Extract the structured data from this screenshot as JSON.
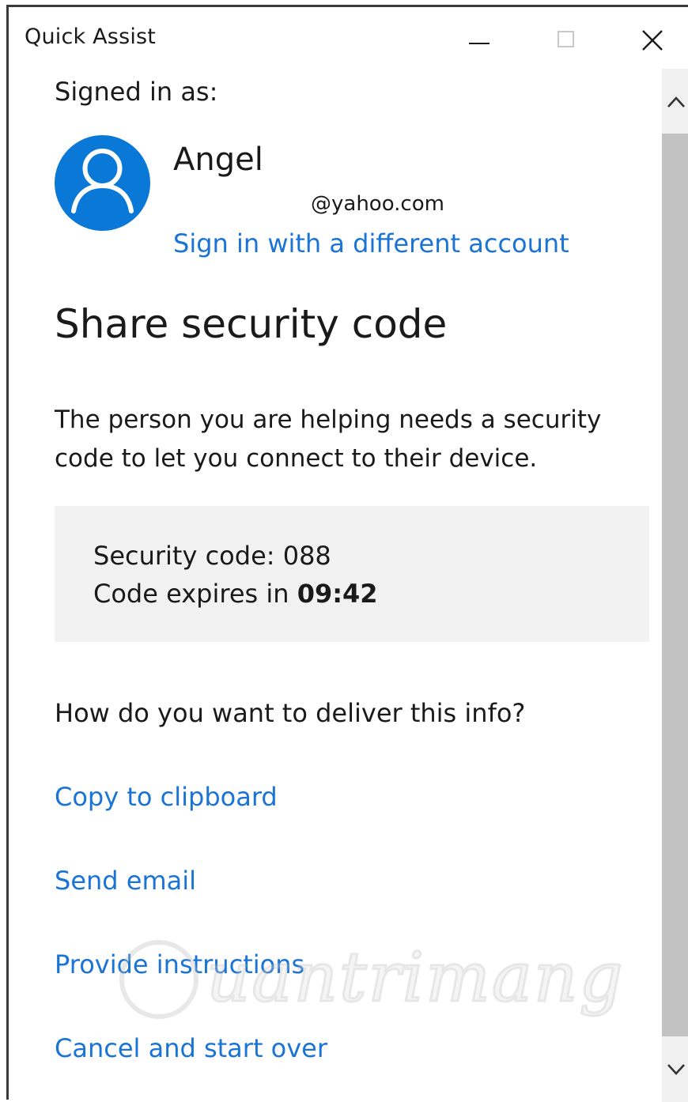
{
  "window": {
    "title": "Quick Assist"
  },
  "account": {
    "signed_in_label": "Signed in as:",
    "name": "Angel",
    "email": "@yahoo.com",
    "switch_link": "Sign in with a different account"
  },
  "main": {
    "heading": "Share security code",
    "description": "The person you are helping needs a security code to let you connect to their device.",
    "code_box": {
      "code_label": "Security code: 088",
      "expires_prefix": "Code expires in ",
      "expires_time": "09:42"
    },
    "deliver_question": "How do you want to deliver this info?",
    "actions": [
      {
        "label": "Copy to clipboard"
      },
      {
        "label": "Send email"
      },
      {
        "label": "Provide instructions"
      },
      {
        "label": "Cancel and start over"
      }
    ]
  },
  "watermark": {
    "text": "uantrimang"
  },
  "colors": {
    "accent": "#0a78d7",
    "link": "#1a73d6",
    "code_box_bg": "#f2f2f2",
    "scroll_thumb": "#c2c2c2"
  },
  "icons": {
    "minimize": "minimize-icon",
    "maximize": "maximize-icon",
    "close": "close-icon",
    "avatar": "user-icon",
    "scroll_up": "chevron-up-icon",
    "scroll_down": "chevron-down-icon"
  }
}
